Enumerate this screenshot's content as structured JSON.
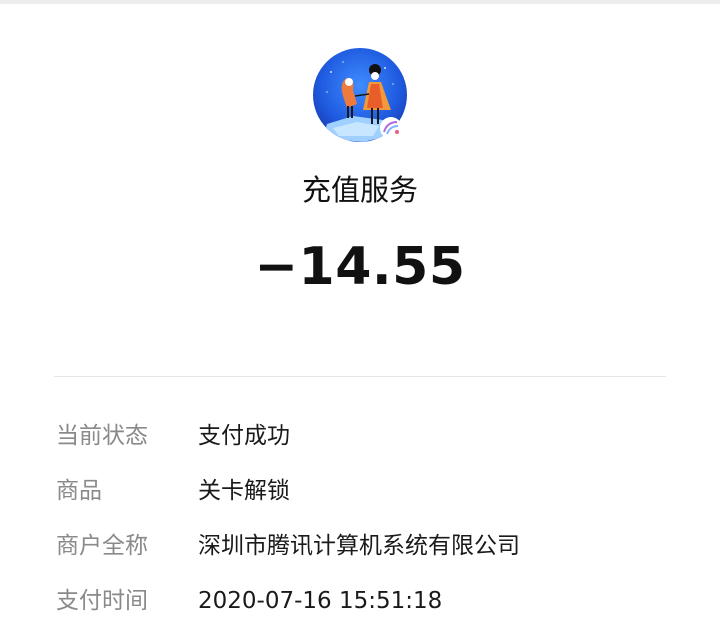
{
  "merchant": {
    "logo_icon": "game-logo-icon",
    "name": "充值服务"
  },
  "amount": "−14.55",
  "details": [
    {
      "label": "当前状态",
      "value": "支付成功"
    },
    {
      "label": "商品",
      "value": "关卡解锁"
    },
    {
      "label": "商户全称",
      "value": "深圳市腾讯计算机系统有限公司"
    },
    {
      "label": "支付时间",
      "value": "2020-07-16 15:51:18"
    }
  ],
  "colors": {
    "background": "#ededed",
    "card": "#ffffff",
    "label": "#8a8a8a",
    "text": "#111111",
    "logo_sky": "#1f5be0"
  }
}
